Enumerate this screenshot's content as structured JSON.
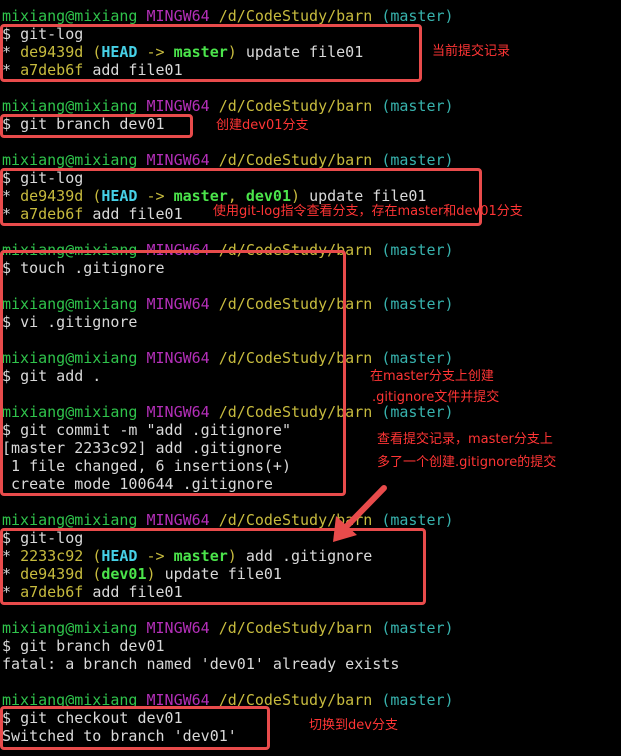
{
  "prompt": {
    "user": "mixiang@mixiang",
    "shell": "MINGW64",
    "path": "/d/CodeStudy/barn",
    "branch_master": "(master)",
    "symbol": "$"
  },
  "blocks": {
    "b1": {
      "cmd": "git-log",
      "l1_hash": "de9439d",
      "l1_open": "(",
      "l1_head": "HEAD",
      "l1_arrow": "->",
      "l1_master": "master",
      "l1_close": ")",
      "l1_msg": "update file01",
      "l2_hash": "a7deb6f",
      "l2_msg": "add file01"
    },
    "b2": {
      "cmd": "git branch dev01"
    },
    "b3": {
      "cmd": "git-log",
      "l1_hash": "de9439d",
      "l1_open": "(",
      "l1_head": "HEAD",
      "l1_arrow": "->",
      "l1_master": "master",
      "l1_comma": ",",
      "l1_dev": "dev01",
      "l1_close": ")",
      "l1_msg": "update file01",
      "l2_hash": "a7deb6f",
      "l2_msg": "add file01"
    },
    "b4": {
      "cmd1": "touch .gitignore",
      "cmd2": "vi .gitignore",
      "cmd3": "git add .",
      "cmd4": "git commit -m \"add .gitignore\"",
      "out1": "[master 2233c92] add .gitignore",
      "out2": " 1 file changed, 6 insertions(+)",
      "out3": " create mode 100644 .gitignore"
    },
    "b5": {
      "cmd": "git-log",
      "l1_hash": "2233c92",
      "l1_open": "(",
      "l1_head": "HEAD",
      "l1_arrow": "->",
      "l1_master": "master",
      "l1_close": ")",
      "l1_msg": "add .gitignore",
      "l2_hash": "de9439d",
      "l2_open": "(",
      "l2_dev": "dev01",
      "l2_close": ")",
      "l2_msg": "update file01",
      "l3_hash": "a7deb6f",
      "l3_msg": "add file01"
    },
    "b6": {
      "cmd": "git branch dev01",
      "out": "fatal: a branch named 'dev01' already exists"
    },
    "b7": {
      "cmd": "git checkout dev01",
      "out": "Switched to branch 'dev01'"
    }
  },
  "annotations": {
    "a1": "当前提交记录",
    "a2": "创建dev01分支",
    "a3": "使用git-log指令查看分支，存在master和dev01分支",
    "a4_l1": "在master分支上创建",
    "a4_l2": ".gitignore文件并提交",
    "a5_l1": "查看提交记录，master分支上",
    "a5_l2": "多了一个创建.gitignore的提交",
    "a6": "切换到dev分支"
  },
  "colors": {
    "prompt_user": "#2fc34b",
    "prompt_shell": "#b32fb8",
    "prompt_path": "#c7bb3e",
    "prompt_branch": "#37b2ad",
    "annotation": "#e84b4b"
  }
}
